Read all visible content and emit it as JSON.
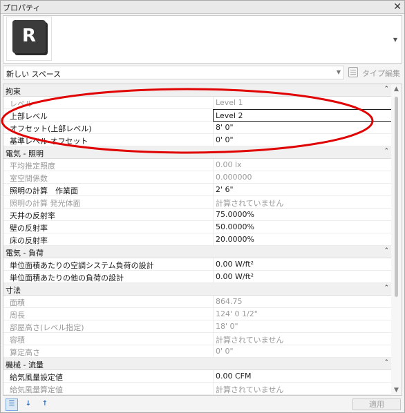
{
  "window": {
    "title": "プロパティ",
    "close": "✕"
  },
  "type_preview": {
    "logo_letter": "R"
  },
  "type_selector": {
    "value": "新しい スペース",
    "edit_type_label": "タイプ編集"
  },
  "groups": [
    {
      "title": "拘束",
      "rows": [
        {
          "name": "レベル",
          "value": "Level 1",
          "readonly": true
        },
        {
          "name": "上部レベル",
          "value": "Level 2",
          "readonly": false,
          "active": true
        },
        {
          "name": "オフセット(上部レベル)",
          "value": "8'  0\"",
          "readonly": false
        },
        {
          "name": "基準レベル オフセット",
          "value": "0'  0\"",
          "readonly": false
        }
      ]
    },
    {
      "title": "電気 - 照明",
      "rows": [
        {
          "name": "平均推定照度",
          "value": "0.00 lx",
          "readonly": true
        },
        {
          "name": "室空間係数",
          "value": "0.000000",
          "readonly": true
        },
        {
          "name": "照明の計算　作業面",
          "value": "2'  6\"",
          "readonly": false
        },
        {
          "name": "照明の計算 発光体面",
          "value": "計算されていません",
          "readonly": true
        },
        {
          "name": "天井の反射率",
          "value": "75.0000%",
          "readonly": false
        },
        {
          "name": "壁の反射率",
          "value": "50.0000%",
          "readonly": false
        },
        {
          "name": "床の反射率",
          "value": "20.0000%",
          "readonly": false
        }
      ]
    },
    {
      "title": "電気 - 負荷",
      "rows": [
        {
          "name": "単位面積あたりの空調システム負荷の設計",
          "value": "0.00 W/ft²",
          "readonly": false
        },
        {
          "name": "単位面積あたりの他の負荷の設計",
          "value": "0.00 W/ft²",
          "readonly": false
        }
      ]
    },
    {
      "title": "寸法",
      "rows": [
        {
          "name": "面積",
          "value": "864.75",
          "readonly": true
        },
        {
          "name": "周長",
          "value": "124'  0 1/2\"",
          "readonly": true
        },
        {
          "name": "部屋高さ(レベル指定)",
          "value": "18'  0\"",
          "readonly": true
        },
        {
          "name": "容積",
          "value": "計算されていません",
          "readonly": true
        },
        {
          "name": "算定高さ",
          "value": "0'  0\"",
          "readonly": true
        }
      ]
    },
    {
      "title": "機械 - 流量",
      "rows": [
        {
          "name": "給気風量設定値",
          "value": "0.00 CFM",
          "readonly": false
        },
        {
          "name": "給気風量算定値",
          "value": "計算されていません",
          "readonly": true
        }
      ]
    }
  ],
  "footer": {
    "apply_label": "適用"
  },
  "colors": {
    "annotation": "#e00000",
    "accent": "#2f6db5"
  }
}
